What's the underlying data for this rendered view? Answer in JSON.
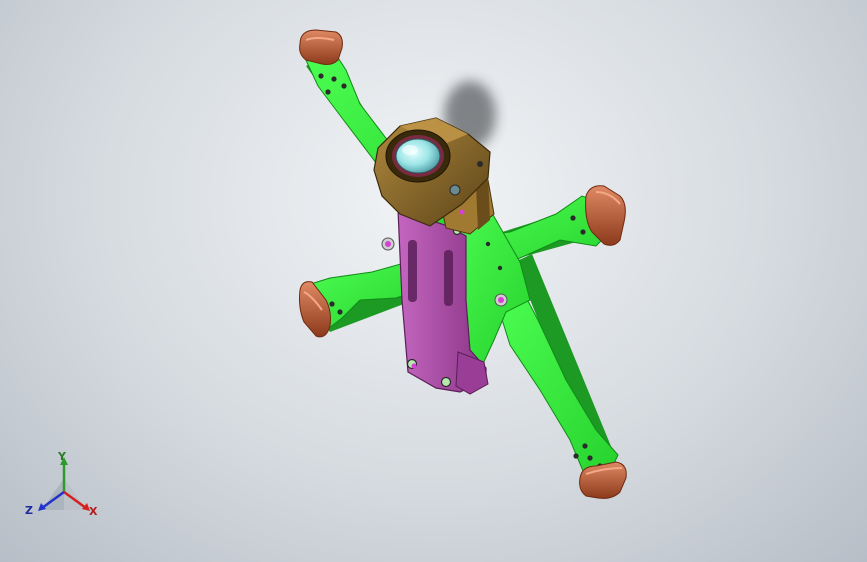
{
  "viewport": {
    "background_top": "#f2f4f6",
    "background_bottom": "#b7bec7"
  },
  "model": {
    "colors": {
      "frame_green": "#35f43b",
      "frame_green_dark": "#1f9c25",
      "plate_purple": "#a94aa6",
      "camera_bronze": "#8a6a2a",
      "lens_cyan": "#a8f0f0",
      "motor_cap": "#c4613c"
    }
  },
  "triad": {
    "x_label": "X",
    "y_label": "Y",
    "z_label": "Z",
    "x_color": "#d62020",
    "y_color": "#2e9a2e",
    "z_color": "#2233cc"
  }
}
